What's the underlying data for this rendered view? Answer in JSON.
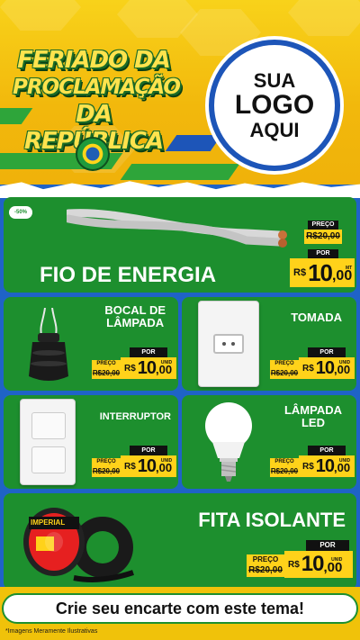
{
  "header": {
    "title_lines": [
      "FERIADO DA",
      "PROCLAMAÇÃO",
      "DA REPÚBLICA"
    ],
    "logo_lines": [
      "SUA",
      "LOGO",
      "AQUI"
    ]
  },
  "colors": {
    "yellow": "#f0c20a",
    "green": "#1d8f2e",
    "blue": "#1f63c7",
    "price_yellow": "#ffd21a"
  },
  "discount_badge": "-50%",
  "products": {
    "fio": {
      "name": "FIO DE ENERGIA",
      "preco_label": "PREÇO",
      "old_price": "R$20,00",
      "por_label": "POR",
      "currency": "R$",
      "price_int": "10",
      "price_cents": ",00",
      "unit": "MT"
    },
    "bocal": {
      "name_lines": [
        "BOCAL DE",
        "LÂMPADA"
      ],
      "preco_label": "PREÇO",
      "old_price": "R$20,00",
      "por_label": "POR",
      "currency": "R$",
      "price_int": "10",
      "price_cents": ",00",
      "unit": "UNID"
    },
    "tomada": {
      "name": "TOMADA",
      "preco_label": "PREÇO",
      "old_price": "R$20,00",
      "por_label": "POR",
      "currency": "R$",
      "price_int": "10",
      "price_cents": ",00",
      "unit": "UNID"
    },
    "interruptor": {
      "name": "INTERRUPTOR",
      "preco_label": "PREÇO",
      "old_price": "R$20,00",
      "por_label": "POR",
      "currency": "R$",
      "price_int": "10",
      "price_cents": ",00",
      "unit": "UNID"
    },
    "lampada": {
      "name_lines": [
        "LÂMPADA",
        "LED"
      ],
      "preco_label": "PREÇO",
      "old_price": "R$20,00",
      "por_label": "POR",
      "currency": "R$",
      "price_int": "10",
      "price_cents": ",00",
      "unit": "UNID"
    },
    "fita": {
      "name": "FITA ISOLANTE",
      "preco_label": "PREÇO",
      "old_price": "R$20,00",
      "por_label": "POR",
      "currency": "R$",
      "price_int": "10",
      "price_cents": ",00",
      "unit": "UNID",
      "tape_brand": "IMPERIAL"
    }
  },
  "footer": {
    "cta": "Crie seu encarte com este tema!",
    "disclaimer": "*Imagens Meramente Ilustrativas"
  }
}
